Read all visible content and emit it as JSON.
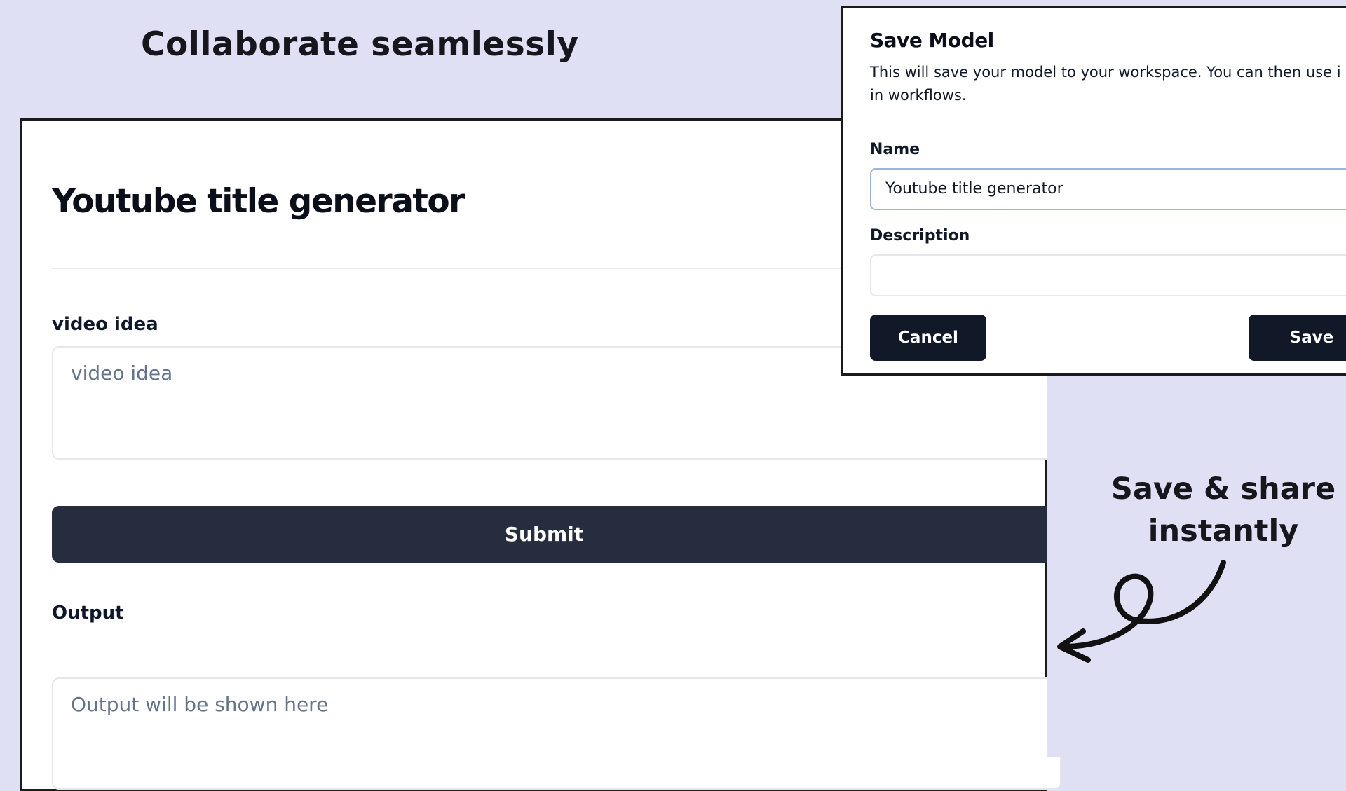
{
  "headline": "Collaborate seamlessly",
  "app": {
    "title": "Youtube title generator",
    "video_label": "video idea",
    "video_placeholder": "video idea",
    "submit_label": "Submit",
    "output_label": "Output",
    "output_placeholder": "Output will be shown here"
  },
  "dialog": {
    "title": "Save Model",
    "description_line1": "This will save your model to your workspace. You can then use i",
    "description_line2": "in workflows.",
    "name_label": "Name",
    "name_value": "Youtube title generator",
    "description_label": "Description",
    "description_value": "",
    "cancel_label": "Cancel",
    "save_label": "Save"
  },
  "annotation": {
    "line1": "Save & share",
    "line2": "instantly"
  },
  "icons": {
    "arrow": "curly-arrow-icon"
  },
  "colors": {
    "background": "#dfe0f3",
    "submit": "#262d3f",
    "dialog_buttons": "#111827",
    "input_focus_border": "#9fb3df"
  }
}
